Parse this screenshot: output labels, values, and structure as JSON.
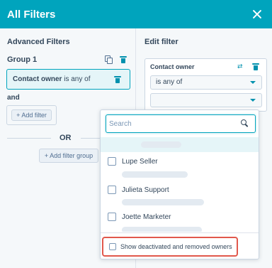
{
  "modal": {
    "title": "All Filters"
  },
  "left_panel": {
    "title": "Advanced Filters",
    "group_title": "Group 1",
    "filter_property": "Contact owner",
    "filter_operator": "is any of",
    "and_label": "and",
    "add_filter_label": "+ Add filter",
    "or_label": "OR",
    "add_filter_group_label": "+ Add filter group"
  },
  "right_panel": {
    "title": "Edit filter",
    "property_label": "Contact owner",
    "operator_value": "is any of",
    "value_select": ""
  },
  "dropdown": {
    "search_placeholder": "Search",
    "options": [
      {
        "label": "Lupe Seller",
        "checked": false
      },
      {
        "label": "Julieta Support",
        "checked": false
      },
      {
        "label": "Joette Marketer",
        "checked": false
      }
    ],
    "deactivated_option": {
      "label": "Show deactivated and removed owners",
      "checked": false
    }
  },
  "colors": {
    "header": "#00a4bd",
    "accent": "#0091ae",
    "highlight_border": "#e1584c",
    "text": "#33475b"
  }
}
